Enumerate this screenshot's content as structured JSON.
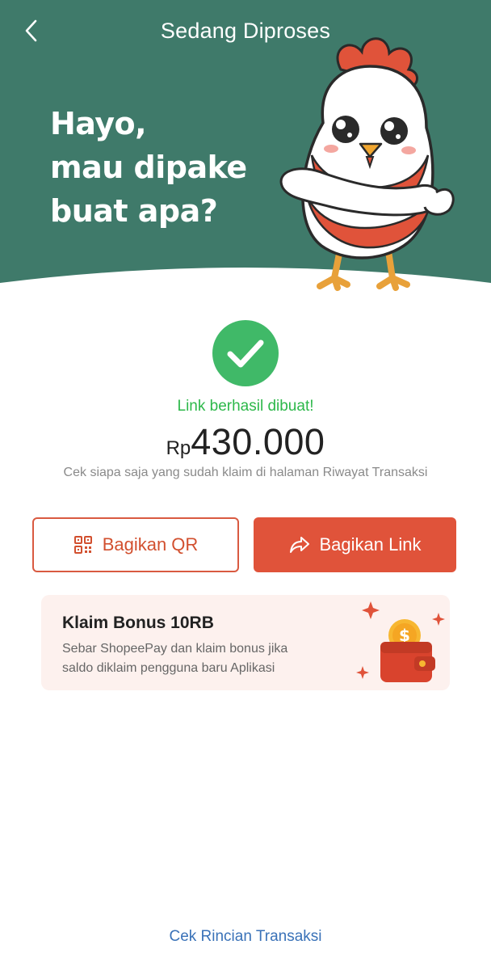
{
  "header": {
    "title": "Sedang Diproses",
    "back_icon": "chevron-left-icon",
    "headline_lines": [
      "Hayo,",
      "mau dipake",
      "buat apa?"
    ],
    "bg_color": "#3f7a6a"
  },
  "status": {
    "icon": "check-circle-icon",
    "message": "Link berhasil dibuat!",
    "currency": "Rp",
    "amount": "430.000",
    "hint": "Cek siapa saja yang sudah klaim di halaman Riwayat Transaksi"
  },
  "actions": {
    "share_qr_label": "Bagikan QR",
    "share_qr_icon": "qr-code-icon",
    "share_link_label": "Bagikan Link",
    "share_link_icon": "share-arrow-icon",
    "accent_color": "#e0533a"
  },
  "bonus": {
    "title": "Klaim Bonus 10RB",
    "description_lines": [
      "Sebar ShopeePay dan klaim bonus jika",
      "saldo diklaim pengguna baru Aplikasi"
    ],
    "icon": "wallet-coin-icon"
  },
  "footer": {
    "link_label": "Cek Rincian Transaksi"
  }
}
